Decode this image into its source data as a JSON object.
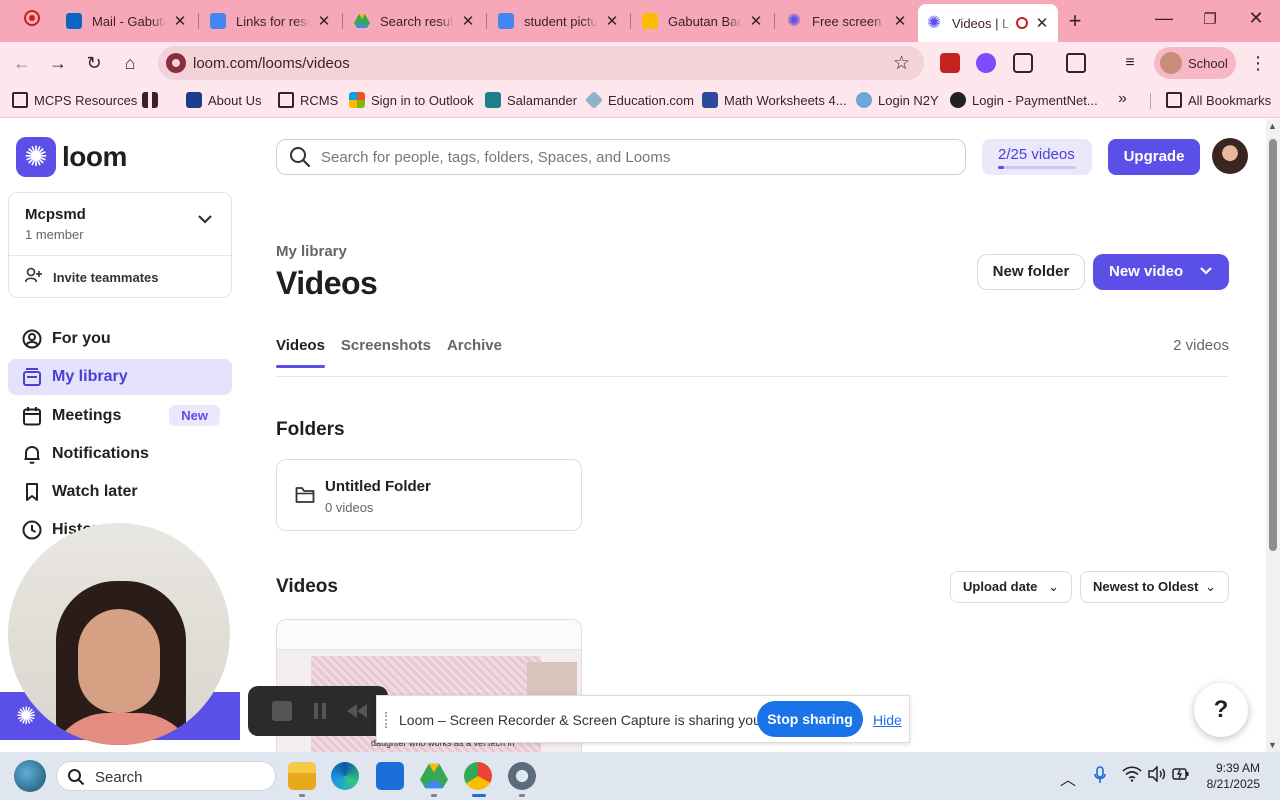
{
  "browser": {
    "tabs": [
      {
        "label": "Mail - Gabutan",
        "icon": "outlook-icon",
        "color": "#0a66c2"
      },
      {
        "label": "Links for resources",
        "icon": "docs-icon",
        "color": "#4285f4"
      },
      {
        "label": "Search results",
        "icon": "drive-icon",
        "color": "#34a853"
      },
      {
        "label": "student pictures",
        "icon": "docs-icon",
        "color": "#4285f4"
      },
      {
        "label": "Gabutan Background",
        "icon": "slides-icon",
        "color": "#fbbc04"
      },
      {
        "label": "Free screen recorder",
        "icon": "loom-icon",
        "color": "#5a4fe6"
      },
      {
        "label": "Videos | Loom",
        "icon": "loom-icon",
        "color": "#5a4fe6"
      }
    ],
    "url": "loom.com/looms/videos",
    "profile_label": "School",
    "bookmarks": [
      {
        "label": "MCPS Resources",
        "icon": "mcps-icon"
      },
      {
        "label": "",
        "icon": "apps-grid-icon"
      },
      {
        "label": "About Us",
        "icon": "site-icon"
      },
      {
        "label": "RCMS",
        "icon": "folder-icon"
      },
      {
        "label": "Sign in to Outlook",
        "icon": "microsoft-icon"
      },
      {
        "label": "Salamander",
        "icon": "salamander-icon"
      },
      {
        "label": "Education.com",
        "icon": "education-icon"
      },
      {
        "label": "Math Worksheets 4...",
        "icon": "mathworksheets-icon"
      },
      {
        "label": "Login N2Y",
        "icon": "n2y-icon"
      },
      {
        "label": "Login - PaymentNet...",
        "icon": "paymentnet-icon"
      }
    ],
    "all_bookmarks_label": "All Bookmarks",
    "overflow_label": "»"
  },
  "sidebar": {
    "logo_text": "loom",
    "workspace": {
      "name": "Mcpsmd",
      "members": "1 member",
      "invite_label": "Invite teammates"
    },
    "items": [
      {
        "label": "For you",
        "icon": "user-circle-icon"
      },
      {
        "label": "My library",
        "icon": "library-icon",
        "active": true
      },
      {
        "label": "Meetings",
        "icon": "calendar-icon",
        "badge": "New"
      },
      {
        "label": "Notifications",
        "icon": "bell-icon"
      },
      {
        "label": "Watch later",
        "icon": "bookmark-icon"
      },
      {
        "label": "History",
        "icon": "clock-icon"
      }
    ]
  },
  "header": {
    "search_placeholder": "Search for people, tags, folders, Spaces, and Looms",
    "video_quota": "2/25 videos",
    "video_quota_fraction": 0.08,
    "upgrade_label": "Upgrade"
  },
  "main": {
    "breadcrumb": "My library",
    "title": "Videos",
    "new_folder_label": "New folder",
    "new_video_label": "New video",
    "tabs": [
      {
        "label": "Videos",
        "active": true
      },
      {
        "label": "Screenshots"
      },
      {
        "label": "Archive"
      }
    ],
    "video_count": "2 videos",
    "folders_heading": "Folders",
    "folder": {
      "name": "Untitled Folder",
      "count": "0 videos"
    },
    "videos_heading": "Videos",
    "sort_by": "Upload date",
    "sort_order": "Newest to Oldest",
    "thumbnail_caption": "daughter who works as a vet tech in",
    "help_label": "?"
  },
  "recording": {
    "share_message": "Loom – Screen Recorder & Screen Capture is sharing your screen.",
    "stop_label": "Stop sharing",
    "hide_label": "Hide"
  },
  "taskbar": {
    "search_label": "Search",
    "apps": [
      "file-explorer-icon",
      "edge-icon",
      "settings-app-icon",
      "drive-icon",
      "chrome-icon",
      "gear-icon"
    ],
    "time": "9:39 AM",
    "date": "8/21/2025"
  }
}
